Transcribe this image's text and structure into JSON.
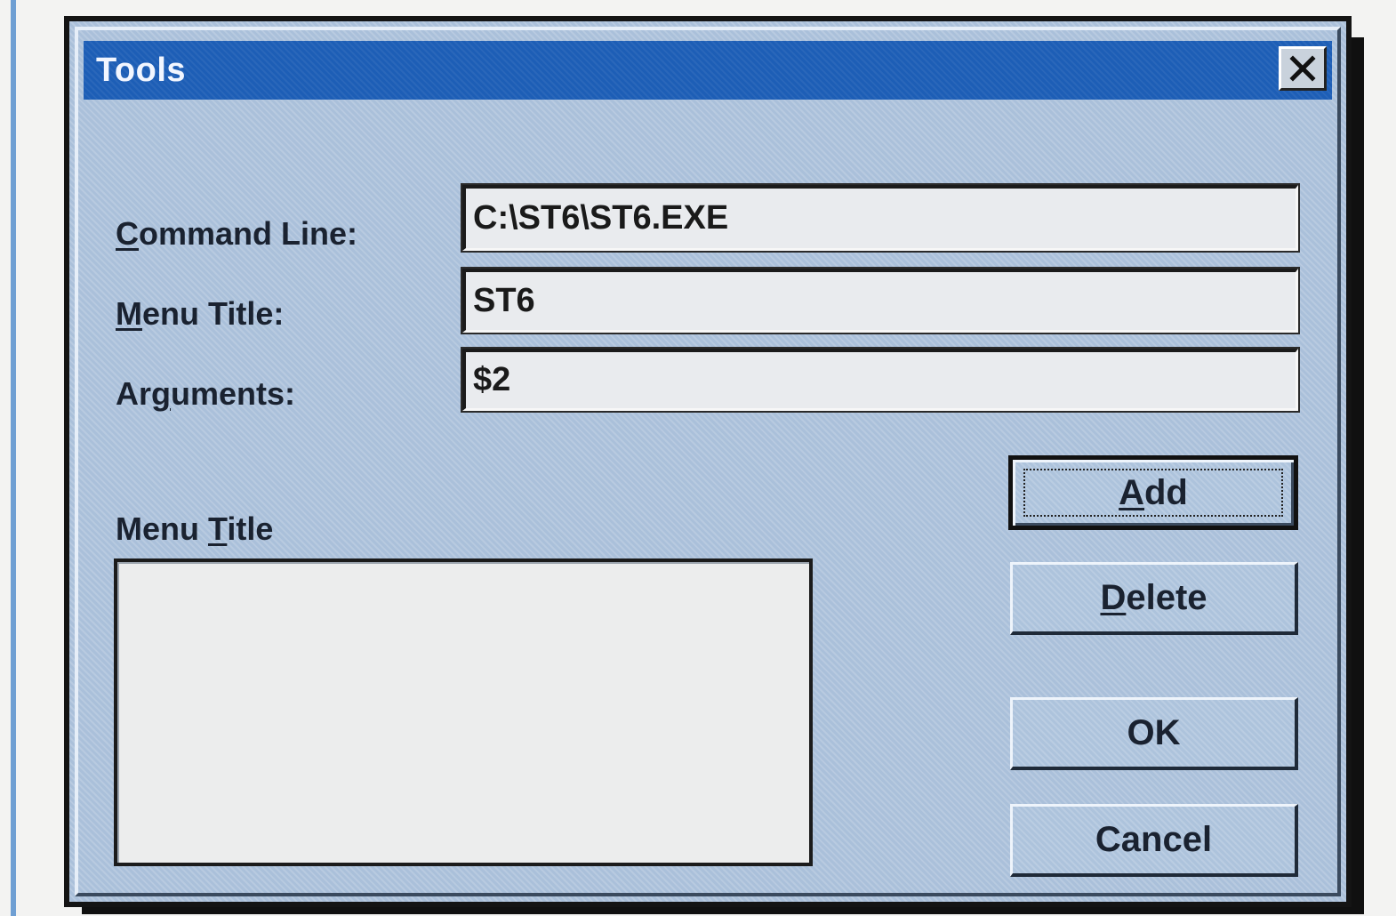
{
  "dialog": {
    "title": "Tools",
    "close_icon": "close-icon"
  },
  "fields": {
    "command_line": {
      "label_mnemonic": "C",
      "label_rest": "ommand Line:",
      "value": "C:\\ST6\\ST6.EXE"
    },
    "menu_title": {
      "label_mnemonic": "M",
      "label_rest": "enu Title:",
      "value": "ST6"
    },
    "arguments": {
      "label_before": "Ar",
      "label_mnemonic": "g",
      "label_rest": "uments:",
      "value": "$2"
    }
  },
  "menu_list": {
    "label_before": "Menu ",
    "label_mnemonic": "T",
    "label_rest": "itle",
    "items": []
  },
  "buttons": {
    "add": {
      "mnemonic": "A",
      "rest": "dd"
    },
    "delete": {
      "mnemonic": "D",
      "rest": "elete"
    },
    "ok": "OK",
    "cancel": "Cancel"
  },
  "colors": {
    "titlebar": "#1d5eb6",
    "dialog_face": "#aac0da"
  }
}
